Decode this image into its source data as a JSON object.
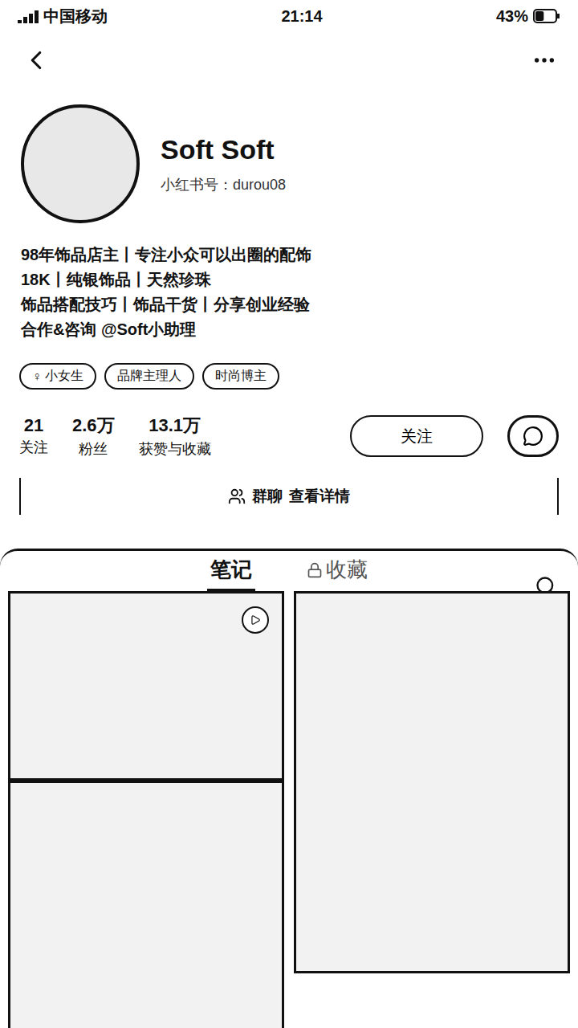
{
  "status_bar": {
    "carrier": "中国移动",
    "time": "21:14",
    "battery": "43%",
    "battery_level": 0.43
  },
  "profile": {
    "name": "Soft Soft",
    "id": "小红书号：durou08",
    "bio": [
      "98年饰品店主丨专注小众可以出圈的配饰",
      "18K丨纯银饰品丨天然珍珠",
      "饰品搭配技巧丨饰品干货丨分享创业经验",
      "合作&咨询 @Soft小助理"
    ],
    "tags": [
      {
        "label": "小女生",
        "icon": "♀"
      },
      {
        "label": "品牌主理人",
        "icon": ""
      },
      {
        "label": "时尚博主",
        "icon": ""
      }
    ],
    "stats": [
      {
        "value": "21",
        "label": "关注"
      },
      {
        "value": "2.6万",
        "label": "粉丝"
      },
      {
        "value": "13.1万",
        "label": "获赞与收藏"
      }
    ],
    "follow_button": "关注",
    "group_chat": {
      "label": "群聊",
      "link": "查看详情"
    }
  },
  "tabs": [
    {
      "label": "笔记",
      "selected": true,
      "locked": false
    },
    {
      "label": "收藏",
      "selected": false,
      "locked": true
    }
  ],
  "notes": [
    {
      "video": true,
      "column": 0
    },
    {
      "video": false,
      "column": 1
    },
    {
      "video": false,
      "column": 0
    }
  ]
}
